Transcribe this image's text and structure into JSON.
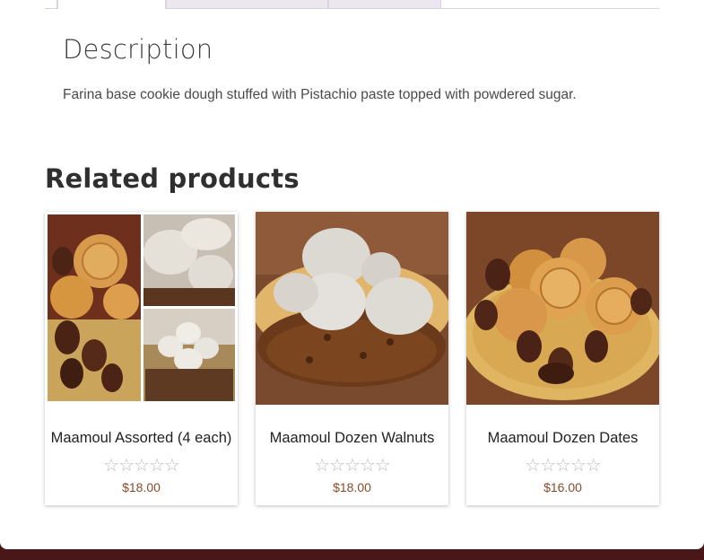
{
  "description": {
    "heading": "Description",
    "text": "Farina base cookie dough stuffed with Pistachio paste topped with powdered sugar."
  },
  "related": {
    "heading": "Related products",
    "products": [
      {
        "title": "Maamoul Assorted (4 each)",
        "price": "$18.00",
        "rating_stars": "☆☆☆☆☆",
        "rating": 0,
        "image": "assorted-maamoul-collage"
      },
      {
        "title": "Maamoul Dozen Walnuts",
        "price": "$18.00",
        "rating_stars": "☆☆☆☆☆",
        "rating": 0,
        "image": "walnut-maamoul-photo"
      },
      {
        "title": "Maamoul Dozen Dates",
        "price": "$16.00",
        "rating_stars": "☆☆☆☆☆",
        "rating": 0,
        "image": "date-maamoul-photo"
      }
    ]
  },
  "colors": {
    "footer": "#4a1718",
    "price": "#8a4a2a",
    "star_empty": "#bdbdbd"
  }
}
